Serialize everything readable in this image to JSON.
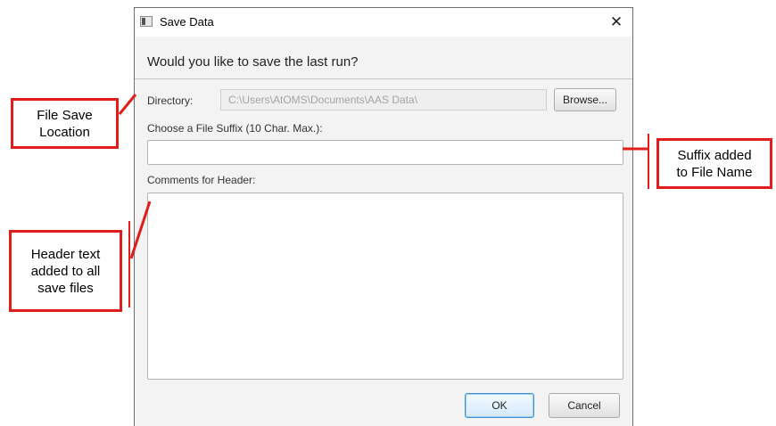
{
  "dialog": {
    "title": "Save Data",
    "close_label": "✕",
    "question": "Would you like to save the last run?",
    "directory_label": "Directory:",
    "directory_value": "C:\\Users\\AtOMS\\Documents\\AAS Data\\",
    "browse_label": "Browse...",
    "suffix_label": "Choose a File Suffix (10 Char. Max.):",
    "suffix_value": "",
    "comments_label": "Comments for Header:",
    "comments_value": "",
    "ok_label": "OK",
    "cancel_label": "Cancel"
  },
  "annotations": {
    "save_location": "File  Save\nLocation",
    "header_text": "Header text\nadded to all\nsave files",
    "suffix_added": "Suffix added\nto File Name"
  },
  "colors": {
    "annotation": "#e21b1b",
    "ok_accent": "#3d8fd6"
  }
}
